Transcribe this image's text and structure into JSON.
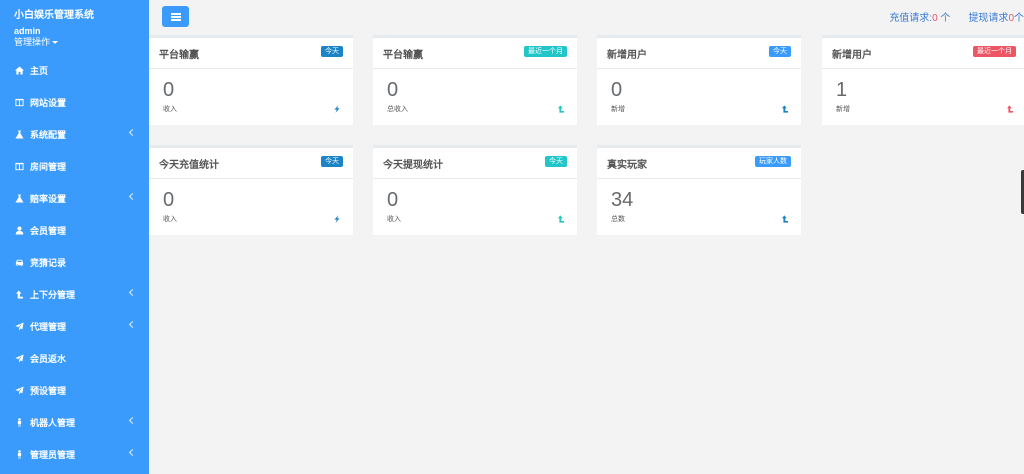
{
  "brand": {
    "title": "小白娱乐管理系统",
    "user": "admin",
    "ops_label": "管理操作"
  },
  "sidebar": {
    "items": [
      {
        "label": "主页",
        "icon": "home-icon",
        "chevron": false
      },
      {
        "label": "网站设置",
        "icon": "columns-icon",
        "chevron": false
      },
      {
        "label": "系统配置",
        "icon": "flask-icon",
        "chevron": true
      },
      {
        "label": "房间管理",
        "icon": "columns-icon",
        "chevron": false
      },
      {
        "label": "赔率设置",
        "icon": "flask-icon",
        "chevron": true
      },
      {
        "label": "会员管理",
        "icon": "user-icon",
        "chevron": false
      },
      {
        "label": "竞猜记录",
        "icon": "car-icon",
        "chevron": false
      },
      {
        "label": "上下分管理",
        "icon": "level-up-icon",
        "chevron": true
      },
      {
        "label": "代理管理",
        "icon": "paper-plane-icon",
        "chevron": true
      },
      {
        "label": "会员返水",
        "icon": "paper-plane-icon",
        "chevron": false
      },
      {
        "label": "预设管理",
        "icon": "paper-plane-icon",
        "chevron": false
      },
      {
        "label": "机器人管理",
        "icon": "male-icon",
        "chevron": true
      },
      {
        "label": "管理员管理",
        "icon": "male-icon",
        "chevron": true
      }
    ]
  },
  "topbar": {
    "recharge_label": "充值请求:",
    "recharge_count": "0",
    "recharge_unit": " 个",
    "withdraw_label": "提现请求",
    "withdraw_count": "0",
    "withdraw_unit": "个"
  },
  "cards": [
    {
      "title": "平台输赢",
      "badge": "今天",
      "badge_color": "#1c84c6",
      "value": "0",
      "sub": "收入",
      "icon": "bolt-icon",
      "icon_color": "#1c84c6"
    },
    {
      "title": "平台输赢",
      "badge": "最近一个月",
      "badge_color": "#23c6c8",
      "value": "0",
      "sub": "总收入",
      "icon": "level-up-icon",
      "icon_color": "#23c6c8"
    },
    {
      "title": "新增用户",
      "badge": "今天",
      "badge_color": "#3a9bfc",
      "value": "0",
      "sub": "新增",
      "icon": "level-up-icon",
      "icon_color": "#1c84c6"
    },
    {
      "title": "新增用户",
      "badge": "最近一个月",
      "badge_color": "#ed5565",
      "value": "1",
      "sub": "新增",
      "icon": "level-up-icon",
      "icon_color": "#ed5565"
    },
    {
      "title": "今天充值统计",
      "badge": "今天",
      "badge_color": "#1c84c6",
      "value": "0",
      "sub": "收入",
      "icon": "bolt-icon",
      "icon_color": "#1c84c6"
    },
    {
      "title": "今天提现统计",
      "badge": "今天",
      "badge_color": "#23c6c8",
      "value": "0",
      "sub": "收入",
      "icon": "level-up-icon",
      "icon_color": "#23c6c8"
    },
    {
      "title": "真实玩家",
      "badge": "玩家人数",
      "badge_color": "#3a9bfc",
      "value": "34",
      "sub": "总数",
      "icon": "level-up-icon",
      "icon_color": "#1c84c6"
    }
  ]
}
